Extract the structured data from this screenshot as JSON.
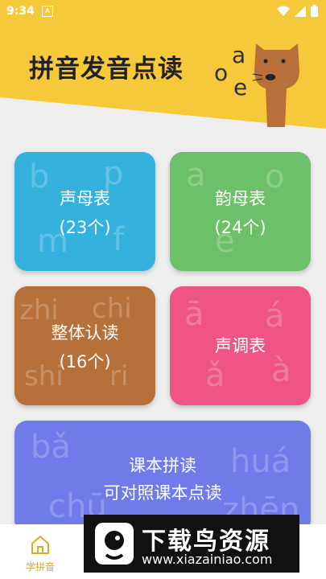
{
  "status": {
    "time": "9:34"
  },
  "header": {
    "title": "拼音发音点读",
    "letters": [
      "a",
      "o",
      "e"
    ]
  },
  "cards": {
    "initials": {
      "line1": "声母表",
      "line2": "(23个)",
      "watermarks": [
        "b",
        "p",
        "m",
        "f"
      ],
      "color": "#34b1dd"
    },
    "finals": {
      "line1": "韵母表",
      "line2": "(24个)",
      "watermarks": [
        "a",
        "o",
        "e"
      ],
      "color": "#6cc06a"
    },
    "whole": {
      "line1": "整体认读",
      "line2": "(16个)",
      "watermarks": [
        "zhi",
        "chi",
        "shi",
        "ri"
      ],
      "color": "#b8703a"
    },
    "tones": {
      "line1": "声调表",
      "watermarks": [
        "ā",
        "á",
        "ǎ",
        "à"
      ],
      "color": "#ee5585"
    },
    "textbook": {
      "line1": "课本拼读",
      "line2": "可对照课本点读",
      "watermarks": [
        "bǎ",
        "huá",
        "chū",
        "zhēn"
      ],
      "color": "#6f7be8"
    }
  },
  "tabbar": {
    "tab1": "学拼音",
    "accent": "#e0a92a"
  },
  "banner": {
    "title": "下载鸟资源",
    "url": "www.xiazainiao.com"
  },
  "icons": [
    "notification-icon",
    "wifi-icon",
    "signal-icon",
    "battery-icon",
    "home-icon",
    "cat-illustration"
  ]
}
